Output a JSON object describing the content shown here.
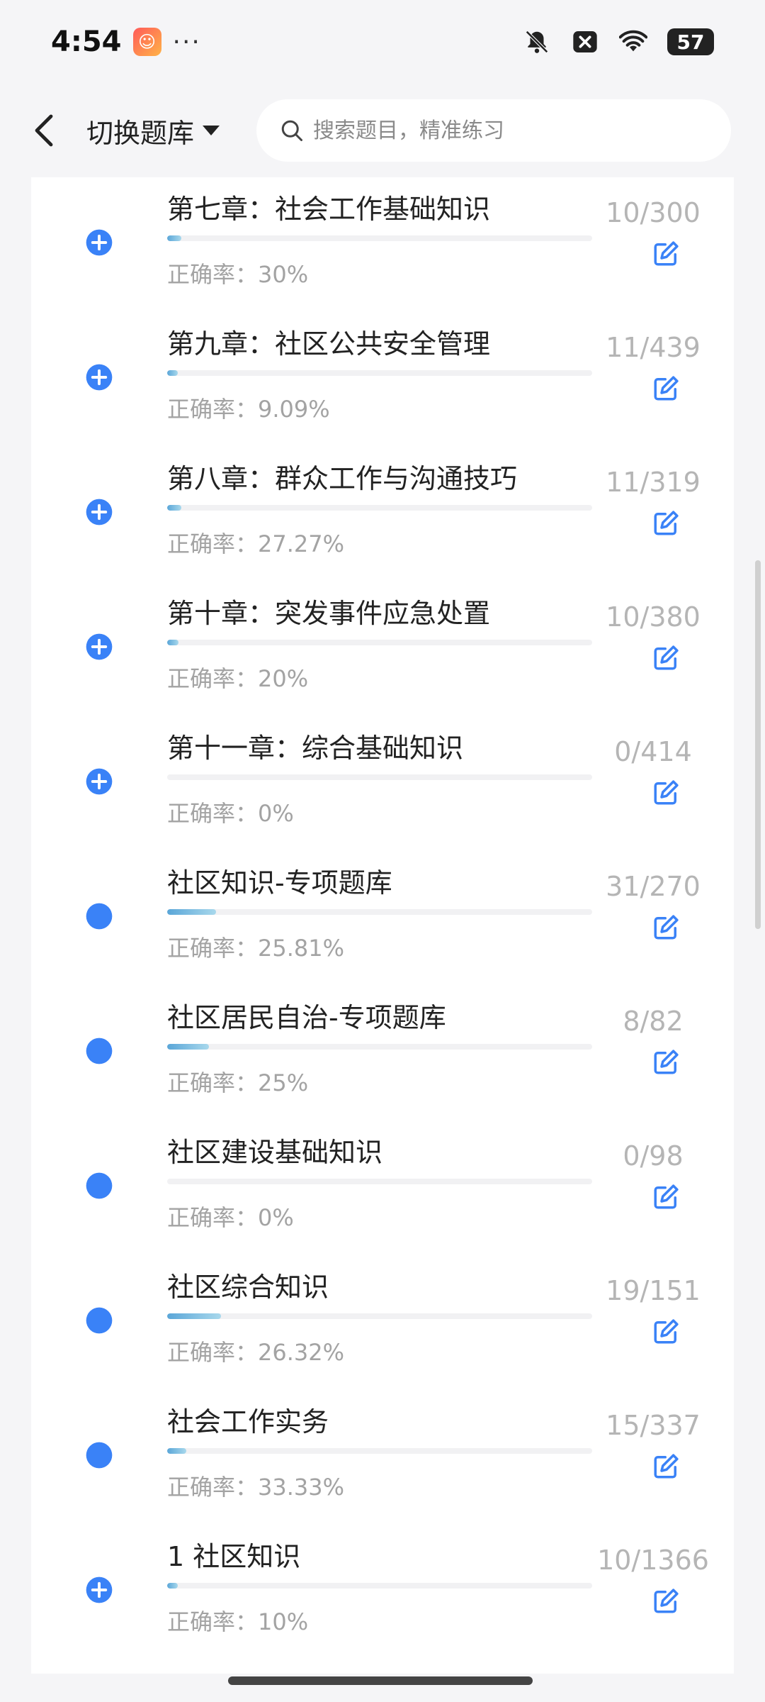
{
  "status_bar": {
    "time": "4:54",
    "dots": "···",
    "battery": "57",
    "icons": [
      "app-badge-icon",
      "bell-muted-icon",
      "close-box-icon",
      "wifi-icon",
      "battery-icon"
    ]
  },
  "header": {
    "switch_label": "切换题库",
    "search_placeholder": "搜索题目，精准练习"
  },
  "colors": {
    "accent": "#3a82f7",
    "progress_start": "#5aa6d8",
    "progress_end": "#a8d8ec",
    "muted_text": "#a3a3a3"
  },
  "items": [
    {
      "title": "第七章：社会工作基础知识",
      "accuracy": "正确率：30%",
      "count": "10/300",
      "progress": 0.033,
      "icon": "plus"
    },
    {
      "title": "第九章：社区公共安全管理",
      "accuracy": "正确率：9.09%",
      "count": "11/439",
      "progress": 0.025,
      "icon": "plus"
    },
    {
      "title": "第八章：群众工作与沟通技巧",
      "accuracy": "正确率：27.27%",
      "count": "11/319",
      "progress": 0.034,
      "icon": "plus"
    },
    {
      "title": "第十章：突发事件应急处置",
      "accuracy": "正确率：20%",
      "count": "10/380",
      "progress": 0.026,
      "icon": "plus"
    },
    {
      "title": "第十一章：综合基础知识",
      "accuracy": "正确率：0%",
      "count": "0/414",
      "progress": 0,
      "icon": "plus"
    },
    {
      "title": "社区知识-专项题库",
      "accuracy": "正确率：25.81%",
      "count": "31/270",
      "progress": 0.115,
      "icon": "dot"
    },
    {
      "title": "社区居民自治-专项题库",
      "accuracy": "正确率：25%",
      "count": "8/82",
      "progress": 0.098,
      "icon": "dot"
    },
    {
      "title": "社区建设基础知识",
      "accuracy": "正确率：0%",
      "count": "0/98",
      "progress": 0,
      "icon": "dot"
    },
    {
      "title": "社区综合知识",
      "accuracy": "正确率：26.32%",
      "count": "19/151",
      "progress": 0.126,
      "icon": "dot"
    },
    {
      "title": "社会工作实务",
      "accuracy": "正确率：33.33%",
      "count": "15/337",
      "progress": 0.045,
      "icon": "dot"
    },
    {
      "title": "1 社区知识",
      "accuracy": "正确率：10%",
      "count": "10/1366",
      "progress": 0.007,
      "icon": "plus"
    }
  ]
}
